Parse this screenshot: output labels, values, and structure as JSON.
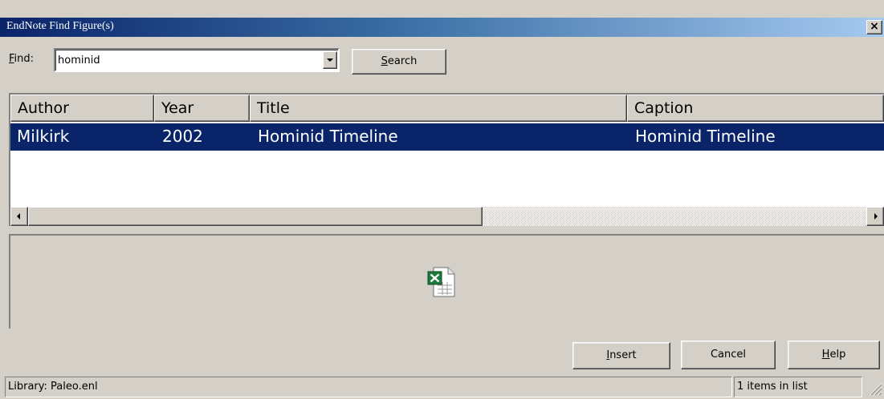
{
  "window": {
    "title": "EndNote Find Figure(s)",
    "close_label": "×"
  },
  "find": {
    "label_accel": "F",
    "label_rest": "ind:",
    "value": "hominid",
    "search_accel": "S",
    "search_rest": "earch"
  },
  "list": {
    "columns": [
      "Author",
      "Year",
      "Title",
      "Caption"
    ],
    "rows": [
      {
        "author": "Milkirk",
        "year": "2002",
        "title": "Hominid Timeline",
        "caption": "Hominid Timeline"
      }
    ],
    "selected_row": 0
  },
  "preview": {
    "icon": "excel-file-icon"
  },
  "buttons": {
    "insert_accel": "I",
    "insert_rest": "nsert",
    "cancel": "Cancel",
    "help_accel": "H",
    "help_rest": "elp"
  },
  "status": {
    "library": "Library: Paleo.enl",
    "count": "1 items in list"
  },
  "colors": {
    "selection": "#0a246a",
    "face": "#d4d0c8",
    "title_start": "#0a246a",
    "title_end": "#a6caf0"
  }
}
